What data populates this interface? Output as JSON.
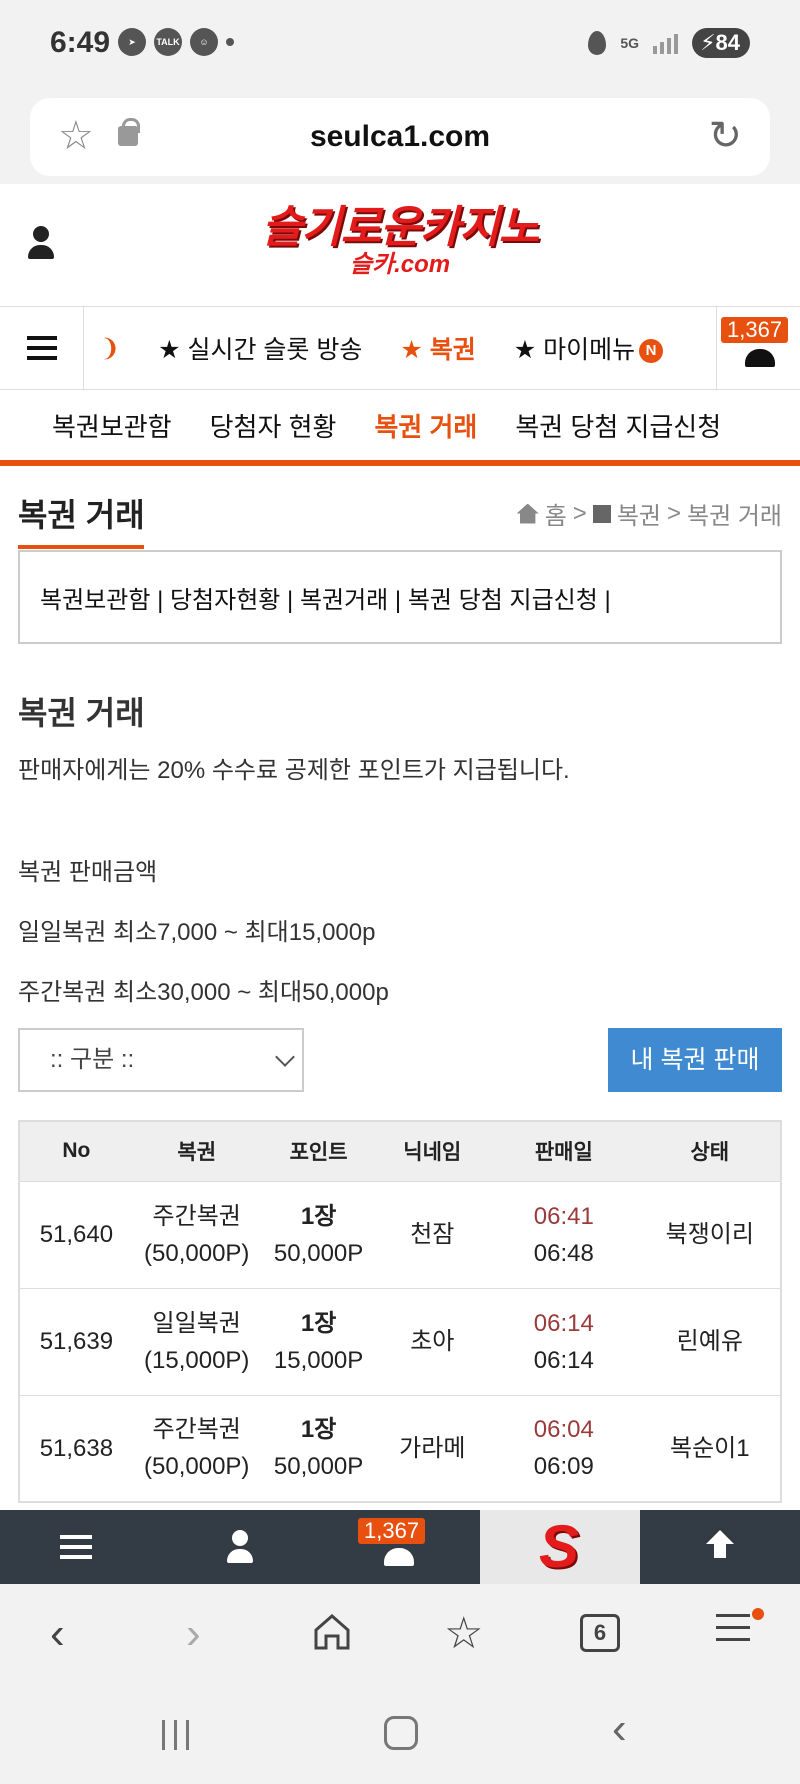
{
  "status_bar": {
    "time": "6:49",
    "icons_left": [
      "navigation-icon",
      "kakao-talk-icon",
      "face-icon",
      "dot"
    ],
    "talk_label": "TALK",
    "network": "5G",
    "battery": "84"
  },
  "browser": {
    "url": "seulca1.com"
  },
  "site_header": {
    "logo_text": "슬기로운카지노",
    "logo_sub": "슬카.com"
  },
  "navbar": {
    "items": [
      {
        "label": "★ 실시간 슬롯 방송",
        "active": false
      },
      {
        "label": "★ 복권",
        "active": true
      },
      {
        "label": "★ 마이메뉴",
        "active": false
      }
    ],
    "new_badge": "N",
    "notification_count": "1,367"
  },
  "subtabs": [
    {
      "label": "복권보관함",
      "active": false
    },
    {
      "label": "당첨자 현황",
      "active": false
    },
    {
      "label": "복권 거래",
      "active": true
    },
    {
      "label": "복권 당첨 지급신청",
      "active": false
    }
  ],
  "page": {
    "title": "복권 거래",
    "breadcrumb": {
      "home": "홈",
      "sep1": ">",
      "section": "복권",
      "sep2": ">",
      "current": "복권 거래"
    },
    "links": "복권보관함 | 당첨자현황 | 복권거래 | 복권 당첨 지급신청 |",
    "section_title": "복권 거래",
    "notice": "판매자에게는 20% 수수료 공제한 포인트가 지급됩니다.",
    "price_heading": "복권 판매금액",
    "daily_range": "일일복권 최소7,000 ~ 최대15,000p",
    "weekly_range": "주간복권 최소30,000 ~ 최대50,000p",
    "select_value": ":: 구분 ::",
    "sell_button": "내 복권 판매"
  },
  "table": {
    "headers": [
      "No",
      "복권",
      "포인트",
      "닉네임",
      "판매일",
      "상태"
    ],
    "rows": [
      {
        "no": "51,640",
        "kind": "주간복권",
        "kind_points": "(50,000P)",
        "qty": "1장",
        "points": "50,000P",
        "nick": "천잠",
        "time1": "06:41",
        "time2": "06:48",
        "state": "북쟁이리"
      },
      {
        "no": "51,639",
        "kind": "일일복권",
        "kind_points": "(15,000P)",
        "qty": "1장",
        "points": "15,000P",
        "nick": "초아",
        "time1": "06:14",
        "time2": "06:14",
        "state": "린예유"
      },
      {
        "no": "51,638",
        "kind": "주간복권",
        "kind_points": "(50,000P)",
        "qty": "1장",
        "points": "50,000P",
        "nick": "가라메",
        "time1": "06:04",
        "time2": "06:09",
        "state": "복순이1"
      }
    ]
  },
  "site_bottom": {
    "notification_count": "1,367",
    "logo_letter": "S"
  },
  "browser_nav": {
    "tab_count": "6"
  },
  "colors": {
    "accent": "#e8500f",
    "button_blue": "#3f8ad1",
    "logo_red": "#e31b1b",
    "toolbar_dark": "#333b44"
  }
}
